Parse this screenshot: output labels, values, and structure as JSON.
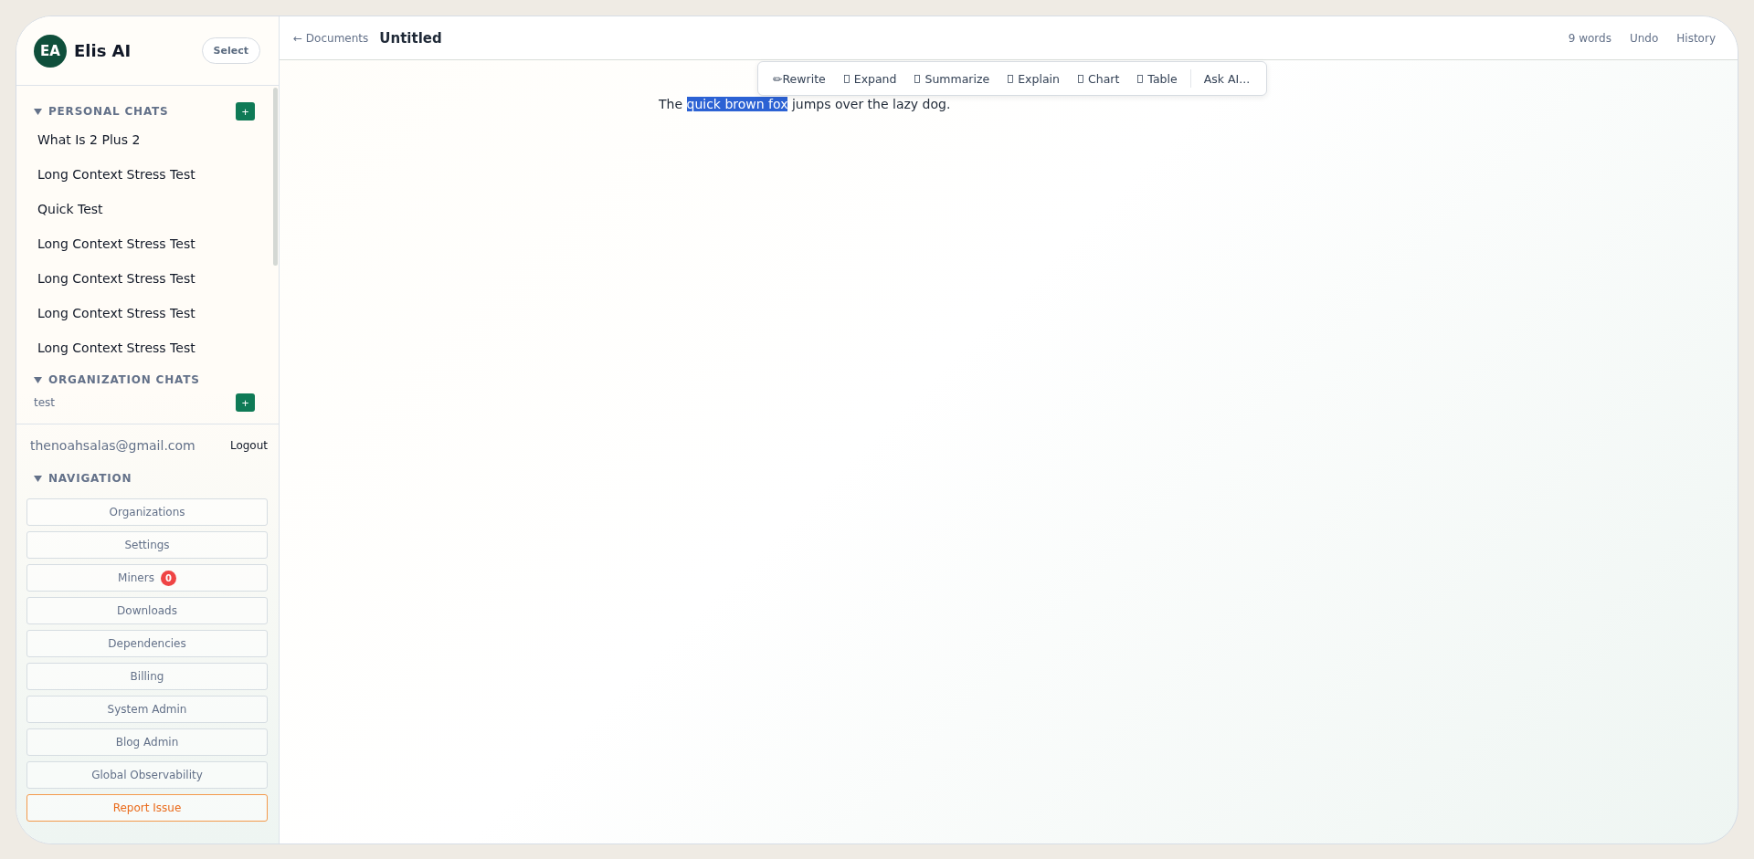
{
  "sidebar": {
    "avatar": "EA",
    "app_name": "Elis AI",
    "select_button": "Select",
    "personal_chats": {
      "title": "PERSONAL CHATS",
      "expanded": true,
      "add": "+",
      "items": [
        "What Is 2 Plus 2",
        "Long Context Stress Test",
        "Quick Test",
        "Long Context Stress Test",
        "Long Context Stress Test",
        "Long Context Stress Test",
        "Long Context Stress Test"
      ]
    },
    "organization_chats": {
      "title": "ORGANIZATION CHATS",
      "expanded": true,
      "items": [
        {
          "label": "test",
          "add": "+"
        }
      ]
    },
    "email": "thenoahsalas@gmail.com",
    "logout": "Logout",
    "navigation": {
      "title": "NAVIGATION",
      "expanded": true,
      "items": [
        {
          "label": "Organizations",
          "kind": "normal"
        },
        {
          "label": "Settings",
          "kind": "normal"
        },
        {
          "label": "Miners",
          "kind": "normal",
          "badge": "0"
        },
        {
          "label": "Downloads",
          "kind": "normal"
        },
        {
          "label": "Dependencies",
          "kind": "normal"
        },
        {
          "label": "Billing",
          "kind": "normal"
        },
        {
          "label": "System Admin",
          "kind": "normal"
        },
        {
          "label": "Blog Admin",
          "kind": "normal"
        },
        {
          "label": "Global Observability",
          "kind": "normal"
        },
        {
          "label": "Report Issue",
          "kind": "warning"
        }
      ]
    }
  },
  "topbar": {
    "back": "← Documents",
    "title": "Untitled",
    "word_count": "9 words",
    "undo": "Undo",
    "history": "History"
  },
  "toolbar": {
    "actions": [
      {
        "label": "Rewrite",
        "icon": "✏",
        "kind": "char"
      },
      {
        "label": "Expand",
        "kind": "box"
      },
      {
        "label": "Summarize",
        "kind": "box"
      },
      {
        "label": "Explain",
        "kind": "box"
      },
      {
        "label": "Chart",
        "kind": "box"
      },
      {
        "label": "Table",
        "kind": "box"
      },
      {
        "label": "Ask AI...",
        "kind": "plain"
      }
    ]
  },
  "document": {
    "segments": [
      {
        "text": "The ",
        "selected": false
      },
      {
        "text": "quick brown fox",
        "selected": true
      },
      {
        "text": " jumps over the lazy dog.",
        "selected": false
      }
    ]
  }
}
